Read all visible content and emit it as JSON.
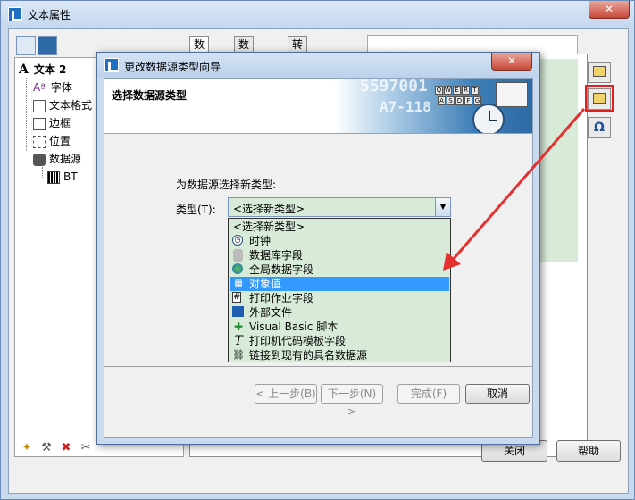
{
  "outer": {
    "title": "文本属性",
    "close": "✕",
    "tabs": [
      "数据源",
      "数据类型",
      "转换"
    ],
    "buttons": {
      "close": "关闭",
      "help": "帮助"
    }
  },
  "tree": {
    "root": "文本 2",
    "items": [
      "字体",
      "文本格式",
      "边框",
      "位置",
      "数据源"
    ],
    "leaf": "BT"
  },
  "dialog": {
    "title": "更改数据源类型向导",
    "close": "✕",
    "header": "选择数据源类型",
    "header_numbers": [
      "5597001",
      "A7-118"
    ],
    "prompt": "为数据源选择新类型:",
    "type_label": "类型(T):",
    "combo_value": "<选择新类型>",
    "options": [
      "<选择新类型>",
      "时钟",
      "数据库字段",
      "全局数据字段",
      "对象值",
      "打印作业字段",
      "外部文件",
      "Visual Basic 脚本",
      "打印机代码模板字段",
      "链接到现有的具名数据源"
    ],
    "selected_index": 4,
    "buttons": {
      "prev": "< 上一步(B)",
      "next": "下一步(N) >",
      "finish": "完成(F)",
      "cancel": "取消"
    }
  },
  "colors": {
    "highlight": "#e02020",
    "selection": "#3399ff",
    "field_green": "#d8ead8"
  }
}
